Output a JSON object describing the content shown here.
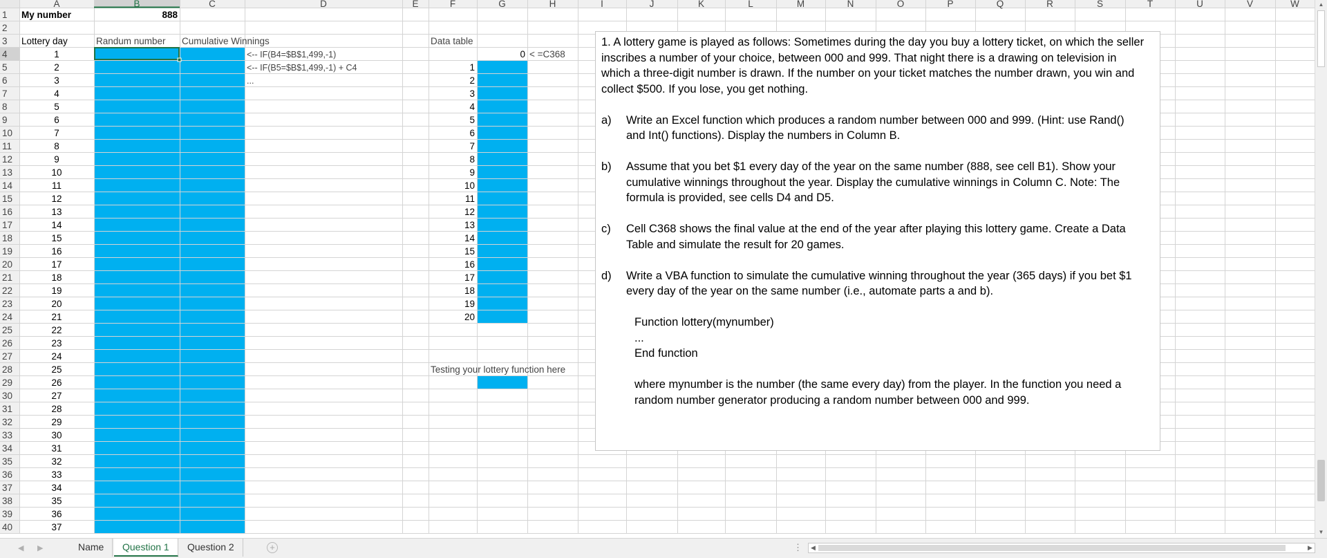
{
  "columns": [
    "A",
    "B",
    "C",
    "D",
    "E",
    "F",
    "G",
    "H",
    "I",
    "J",
    "K",
    "L",
    "M",
    "N",
    "O",
    "P",
    "Q",
    "R",
    "S",
    "T",
    "U",
    "V",
    "W"
  ],
  "rows": [
    "1",
    "2",
    "3",
    "4",
    "5",
    "6",
    "7",
    "8",
    "9",
    "10",
    "11",
    "12",
    "13",
    "14",
    "15",
    "16",
    "17",
    "18",
    "19",
    "20",
    "21",
    "22",
    "23",
    "24",
    "25",
    "26",
    "27",
    "28",
    "29",
    "30",
    "31",
    "32",
    "33",
    "34",
    "35",
    "36",
    "37",
    "38",
    "39",
    "40"
  ],
  "cells": {
    "A1": "My number",
    "B1": "888",
    "A3": "Lottery day",
    "B3": "Randum number",
    "C3": "Cumulative Winnings",
    "D4": "<-- IF(B4=$B$1,499,-1)",
    "D5": "<-- IF(B5=$B$1,499,-1) + C4",
    "D6": "...",
    "F3": "Data table",
    "G4": "0",
    "H4": "< =C368",
    "F28": "Testing your lottery function here"
  },
  "lottery_days": [
    "1",
    "2",
    "3",
    "4",
    "5",
    "6",
    "7",
    "8",
    "9",
    "10",
    "11",
    "12",
    "13",
    "14",
    "15",
    "16",
    "17",
    "18",
    "19",
    "20",
    "21",
    "22",
    "23",
    "24",
    "25",
    "26",
    "27",
    "28",
    "29",
    "30",
    "31",
    "32",
    "33",
    "34",
    "35",
    "36",
    "37"
  ],
  "data_table_index": [
    "1",
    "2",
    "3",
    "4",
    "5",
    "6",
    "7",
    "8",
    "9",
    "10",
    "11",
    "12",
    "13",
    "14",
    "15",
    "16",
    "17",
    "18",
    "19",
    "20"
  ],
  "selected_cell": "B4",
  "colors": {
    "fill": "#00b0f0",
    "selection": "#217346",
    "grid": "#d4d4d4",
    "header_bg": "#f0f0f0"
  },
  "note": {
    "q1": "1.  A lottery game is played as follows: Sometimes during the day you buy a lottery ticket, on which the seller inscribes a number of your choice, between 000 and 999. That night there is a drawing on television in which a three-digit number is drawn. If the number on your ticket matches the number drawn, you win and collect $500. If you lose, you get nothing.",
    "a_label": "a)",
    "a": "Write an Excel function which produces a random number between 000 and 999. (Hint: use Rand() and Int() functions). Display the numbers in Column B.",
    "b_label": "b)",
    "b": "Assume that you bet $1 every day of the year on the same number (888, see cell B1). Show your cumulative winnings throughout the year. Display the cumulative winnings in Column C. Note: The formula is provided, see cells D4 and D5.",
    "c_label": "c)",
    "c": "Cell C368 shows the final value at the end of the year after playing this lottery game. Create a Data Table and simulate the result for 20 games.",
    "d_label": "d)",
    "d": "Write a VBA function to simulate the cumulative winning throughout the year (365 days) if you bet $1 every day of the year on the same number (i.e., automate parts a and b).",
    "code1": "Function lottery(mynumber)",
    "code2": "...",
    "code3": "End function",
    "where": "where mynumber is the number (the same every day) from the player. In the function you need a random number generator producing a random number between 000 and 999."
  },
  "sheet_tabs": [
    "Name",
    "Question 1",
    "Question 2"
  ],
  "active_tab": "Question 1"
}
